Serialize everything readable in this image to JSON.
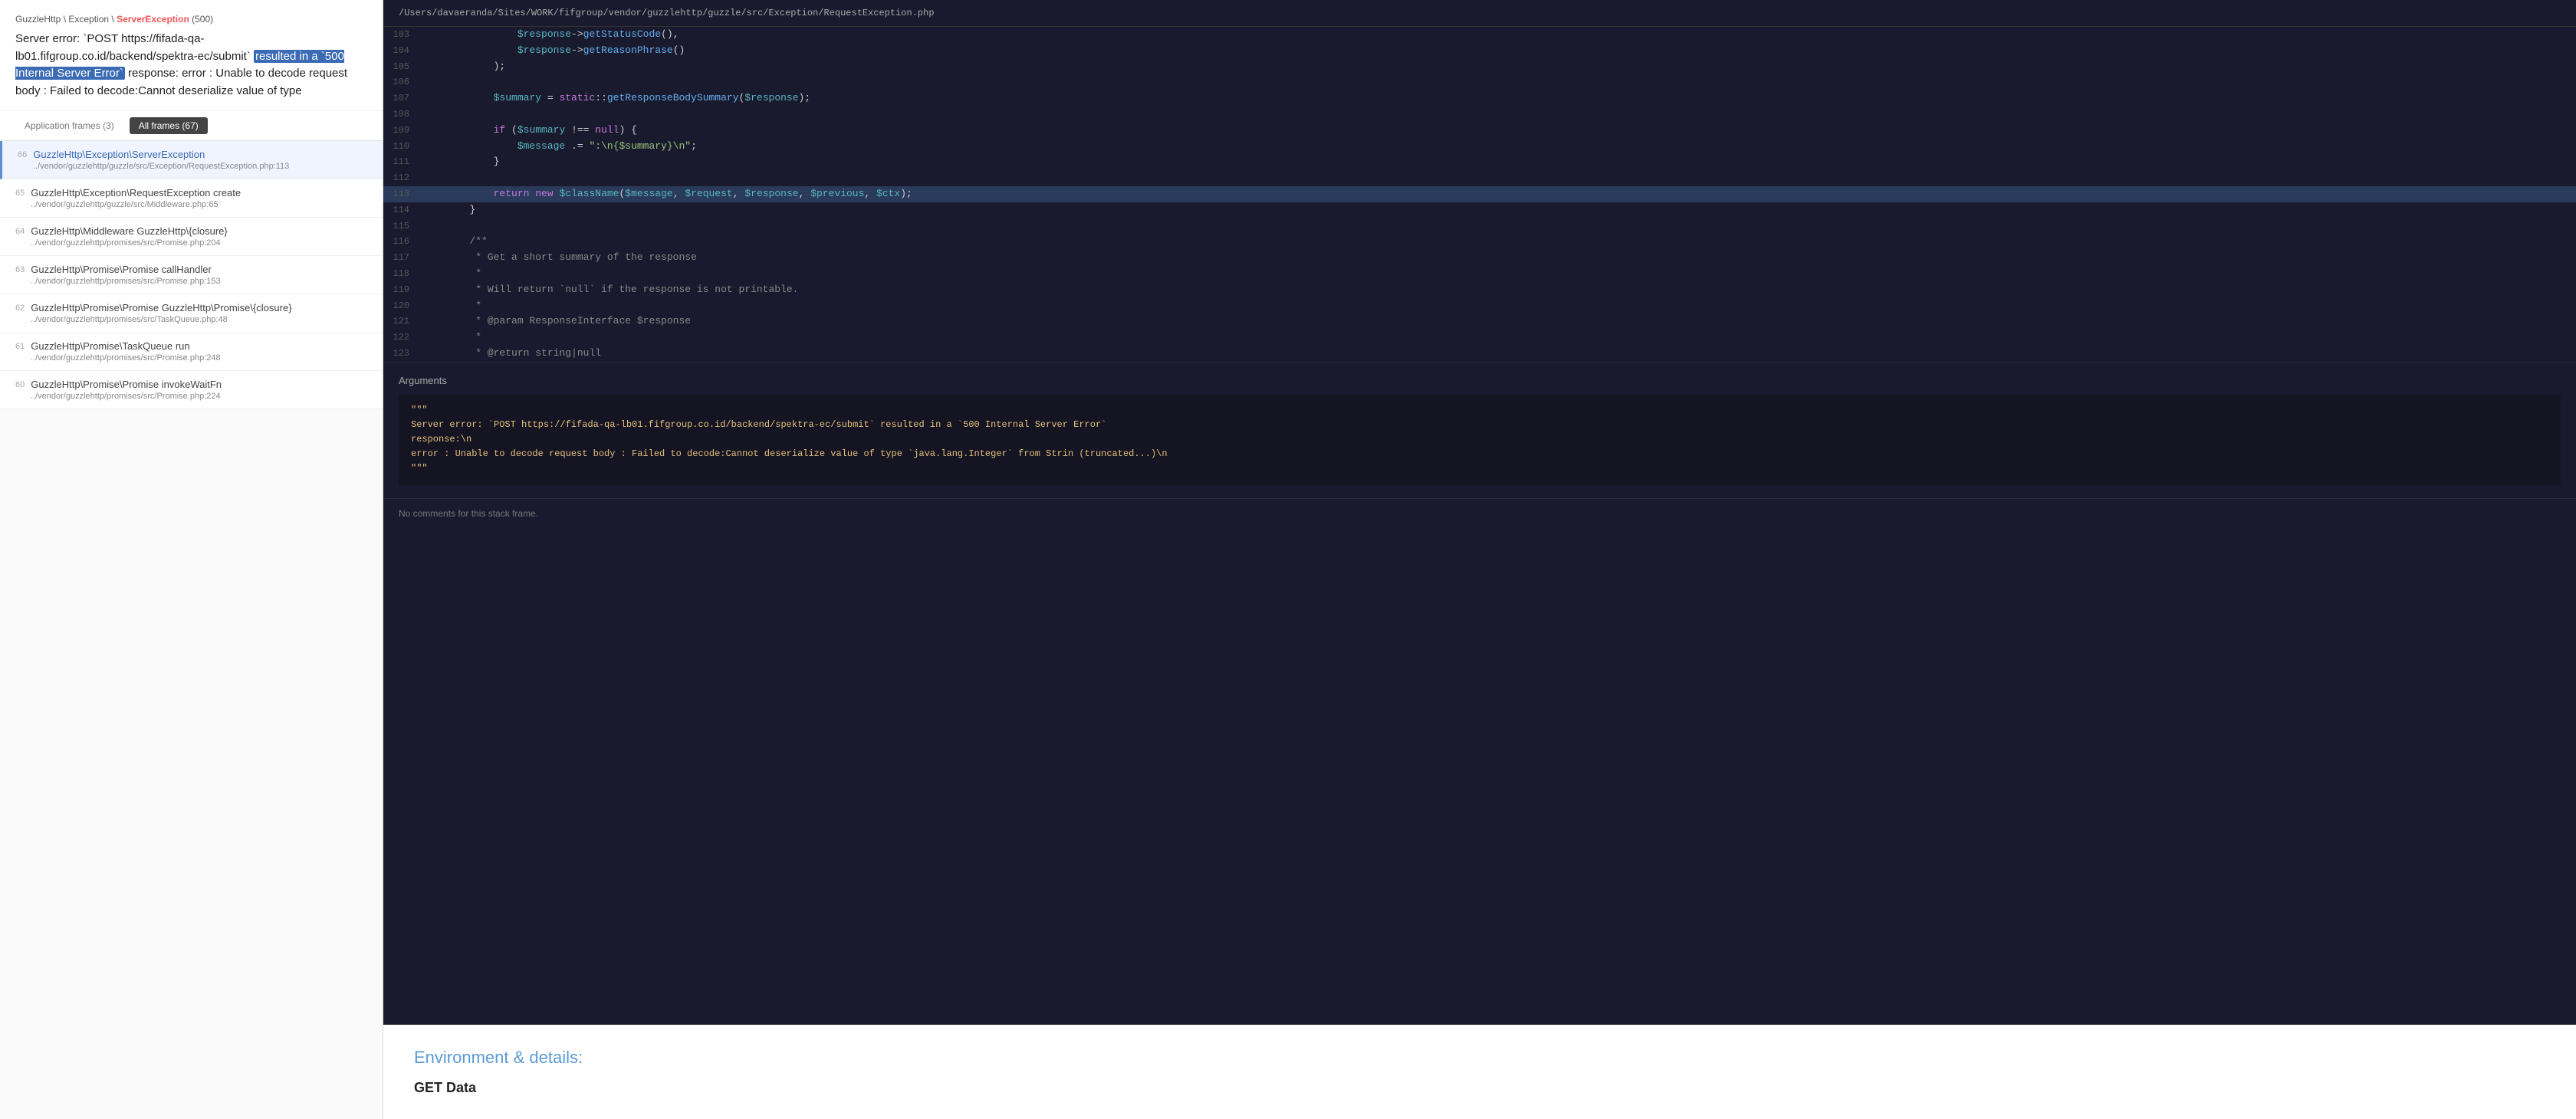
{
  "left": {
    "breadcrumb": {
      "prefix": "GuzzleHttp \\ Exception \\ ",
      "exception": "ServerException",
      "suffix": " (500)"
    },
    "error_message": "Server error: `POST https://fifada-qa-lb01.fifgroup.co.id/backend/spektra-ec/submit` resulted in a `500 Internal Server Error` response: error : Unable to decode request body : Failed to decode:Cannot deserialize value of type",
    "highlight_text": "resulted in a `500 Internal Server Error`",
    "frames_toggle": {
      "app_frames": "Application frames (3)",
      "all_frames": "All frames (67)"
    },
    "frames": [
      {
        "number": "66",
        "class": "GuzzleHttp\\Exception\\ServerException",
        "file": "../vendor/guzzlehttp/guzzle/src/Exception/RequestException.php:113",
        "is_vendor": false,
        "active": true
      },
      {
        "number": "65",
        "class": "GuzzleHttp\\Exception\\RequestException create",
        "file": "../vendor/guzzlehttp/guzzle/src/Middleware.php:65",
        "is_vendor": true
      },
      {
        "number": "64",
        "class": "GuzzleHttp\\Middleware GuzzleHttp\\{closure}",
        "file": "../vendor/guzzlehttp/promises/src/Promise.php:204",
        "is_vendor": true
      },
      {
        "number": "63",
        "class": "GuzzleHttp\\Promise\\Promise callHandler",
        "file": "../vendor/guzzlehttp/promises/src/Promise.php:153",
        "is_vendor": true
      },
      {
        "number": "62",
        "class": "GuzzleHttp\\Promise\\Promise GuzzleHttp\\Promise\\{closure}",
        "file": "../vendor/guzzlehttp/promises/src/TaskQueue.php:48",
        "is_vendor": true
      },
      {
        "number": "61",
        "class": "GuzzleHttp\\Promise\\TaskQueue run",
        "file": "../vendor/guzzlehttp/promises/src/Promise.php:248",
        "is_vendor": true
      },
      {
        "number": "60",
        "class": "GuzzleHttp\\Promise\\Promise invokeWaitFn",
        "file": "../vendor/guzzlehttp/promises/src/Promise.php:224",
        "is_vendor": true
      }
    ]
  },
  "right": {
    "file_path": "/Users/davaeranda/Sites/WORK/fifgroup/vendor/guzzlehttp/guzzle/src/Exception/RequestException.php",
    "code_lines": [
      {
        "number": 103,
        "content": "                $response->getStatusCode(),",
        "highlighted": false
      },
      {
        "number": 104,
        "content": "                $response->getReasonPhrase()",
        "highlighted": false
      },
      {
        "number": 105,
        "content": "            );",
        "highlighted": false
      },
      {
        "number": 106,
        "content": "",
        "highlighted": false
      },
      {
        "number": 107,
        "content": "            $summary = static::getResponseBodySummary($response);",
        "highlighted": false
      },
      {
        "number": 108,
        "content": "",
        "highlighted": false
      },
      {
        "number": 109,
        "content": "            if ($summary !== null) {",
        "highlighted": false
      },
      {
        "number": 110,
        "content": "                $message .= \":\\n{$summary}\\n\";",
        "highlighted": false
      },
      {
        "number": 111,
        "content": "            }",
        "highlighted": false
      },
      {
        "number": 112,
        "content": "",
        "highlighted": false
      },
      {
        "number": 113,
        "content": "            return new $className($message, $request, $response, $previous, $ctx);",
        "highlighted": true
      },
      {
        "number": 114,
        "content": "        }",
        "highlighted": false
      },
      {
        "number": 115,
        "content": "",
        "highlighted": false
      },
      {
        "number": 116,
        "content": "        /**",
        "highlighted": false
      },
      {
        "number": 117,
        "content": "         * Get a short summary of the response",
        "highlighted": false
      },
      {
        "number": 118,
        "content": "         *",
        "highlighted": false
      },
      {
        "number": 119,
        "content": "         * Will return `null` if the response is not printable.",
        "highlighted": false
      },
      {
        "number": 120,
        "content": "         *",
        "highlighted": false
      },
      {
        "number": 121,
        "content": "         * @param ResponseInterface $response",
        "highlighted": false
      },
      {
        "number": 122,
        "content": "         *",
        "highlighted": false
      },
      {
        "number": 123,
        "content": "         * @return string|null",
        "highlighted": false
      }
    ],
    "arguments_label": "Arguments",
    "arguments_content": "\"\"\"\nServer error: `POST https://fifada-qa-lb01.fifgroup.co.id/backend/spektra-ec/submit` resulted in a `500 Internal Server Error`\nresponse:\\n\nerror : Unable to decode request body : Failed to decode:Cannot deserialize value of type `java.lang.Integer` from Strin (truncated...)\\n\n\"\"\"",
    "no_comments": "No comments for this stack frame.",
    "environment_title": "Environment & details:",
    "get_data_title": "GET Data"
  }
}
